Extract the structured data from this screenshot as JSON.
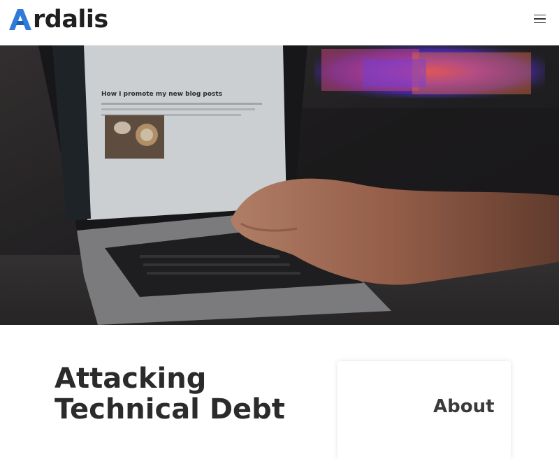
{
  "header": {
    "logo_text": "rdalis",
    "logo_brand": "Ardalis",
    "menu_icon": "hamburger-menu-icon",
    "colors": {
      "logo_blue": "#2f7bd9",
      "logo_dark": "#1f1f1f"
    }
  },
  "hero": {
    "image": "laptop-blog-editor-photo",
    "screen_heading": "How I promote my new blog posts"
  },
  "main": {
    "post_title": "Attacking Technical Debt"
  },
  "sidebar": {
    "heading": "About"
  }
}
